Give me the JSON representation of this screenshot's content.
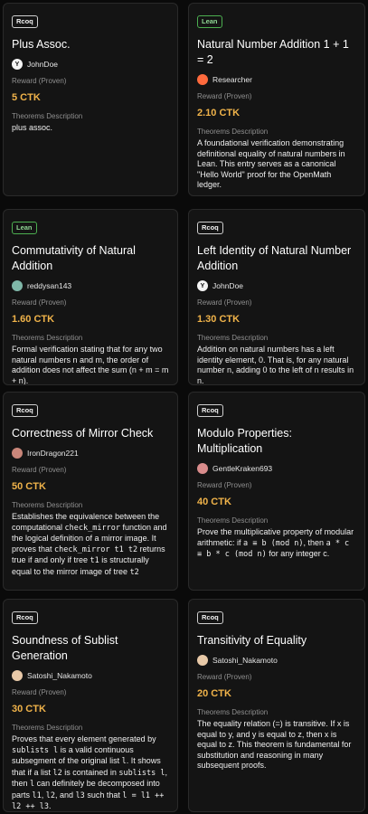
{
  "cards": [
    {
      "tag": "Rcoq",
      "tag_kind": "coq",
      "title": "Plus Assoc.",
      "author": "JohnDoe",
      "avatar_color": "#f5f5f5",
      "avatar_glyph": "Y",
      "reward_label": "Reward (Proven)",
      "reward": "5 CTK",
      "desc_label": "Theorems Description",
      "desc": [
        {
          "t": "plus assoc."
        }
      ]
    },
    {
      "tag": "Lean",
      "tag_kind": "lean",
      "title": "Natural Number Addition 1 + 1 = 2",
      "author": "Researcher",
      "avatar_color": "#ff6a3d",
      "avatar_glyph": "",
      "reward_label": "Reward (Proven)",
      "reward": "2.10 CTK",
      "desc_label": "Theorems Description",
      "desc": [
        {
          "t": "A foundational verification demonstrating definitional equality of natural numbers in Lean. This entry serves as a canonical \"Hello World\" proof for the OpenMath ledger."
        }
      ]
    },
    {
      "tag": "Lean",
      "tag_kind": "lean",
      "title": "Commutativity of Natural Addition",
      "author": "reddysan143",
      "avatar_color": "#7fb7a8",
      "avatar_glyph": "",
      "reward_label": "Reward (Proven)",
      "reward": "1.60 CTK",
      "desc_label": "Theorems Description",
      "desc": [
        {
          "t": "Formal verification stating that for any two natural numbers n and m, the order of addition does not affect the sum (n + m = m + n)."
        }
      ]
    },
    {
      "tag": "Rcoq",
      "tag_kind": "coq",
      "title": "Left Identity of Natural Number Addition",
      "author": "JohnDoe",
      "avatar_color": "#f5f5f5",
      "avatar_glyph": "Y",
      "reward_label": "Reward (Proven)",
      "reward": "1.30 CTK",
      "desc_label": "Theorems Description",
      "desc": [
        {
          "t": "Addition on natural numbers has a left identity element, 0. That is, for any natural number n, adding 0 to the left of n results in n."
        }
      ]
    },
    {
      "tag": "Rcoq",
      "tag_kind": "coq",
      "title": "Correctness of Mirror Check",
      "author": "IronDragon221",
      "avatar_color": "#c9867a",
      "avatar_glyph": "",
      "reward_label": "Reward (Proven)",
      "reward": "50 CTK",
      "desc_label": "Theorems Description",
      "desc": [
        {
          "t": "Establishes the equivalence between the computational "
        },
        {
          "t": "check_mirror",
          "m": true
        },
        {
          "t": " function and the logical definition of a mirror image. It proves that "
        },
        {
          "t": "check_mirror t1 t2",
          "m": true
        },
        {
          "t": " returns true if and only if tree "
        },
        {
          "t": "t1",
          "m": true
        },
        {
          "t": " is structurally equal to the mirror image of tree "
        },
        {
          "t": "t2",
          "m": true
        }
      ]
    },
    {
      "tag": "Rcoq",
      "tag_kind": "coq",
      "title": "Modulo Properties: Multiplication",
      "author": "GentleKraken693",
      "avatar_color": "#d98c8c",
      "avatar_glyph": "",
      "reward_label": "Reward (Proven)",
      "reward": "40 CTK",
      "desc_label": "Theorems Description",
      "desc": [
        {
          "t": "Prove the multiplicative property of modular arithmetic: if "
        },
        {
          "t": "a ≡ b (mod n)",
          "m": true
        },
        {
          "t": ", then "
        },
        {
          "t": "a * c ≡ b * c (mod n)",
          "m": true
        },
        {
          "t": " for any integer c."
        }
      ]
    },
    {
      "tag": "Rcoq",
      "tag_kind": "coq",
      "title": "Soundness of Sublist Generation",
      "author": "Satoshi_Nakamoto",
      "avatar_color": "#e8c9a8",
      "avatar_glyph": "",
      "reward_label": "Reward (Proven)",
      "reward": "30 CTK",
      "desc_label": "Theorems Description",
      "desc": [
        {
          "t": "Proves that every element generated by "
        },
        {
          "t": "sublists l",
          "m": true
        },
        {
          "t": " is a valid continuous subsegment of the original list "
        },
        {
          "t": "l",
          "m": true
        },
        {
          "t": ". It shows that if a list "
        },
        {
          "t": "l2",
          "m": true
        },
        {
          "t": " is contained in "
        },
        {
          "t": "sublists l",
          "m": true
        },
        {
          "t": ", then "
        },
        {
          "t": "l",
          "m": true
        },
        {
          "t": " can definitely be decomposed into parts "
        },
        {
          "t": "l1",
          "m": true
        },
        {
          "t": ", "
        },
        {
          "t": "l2",
          "m": true
        },
        {
          "t": ", and "
        },
        {
          "t": "l3",
          "m": true
        },
        {
          "t": " such that "
        },
        {
          "t": "l = l1 ++ l2 ++ l3",
          "m": true
        },
        {
          "t": "."
        }
      ]
    },
    {
      "tag": "Rcoq",
      "tag_kind": "coq",
      "title": "Transitivity of Equality",
      "author": "Satoshi_Nakamoto",
      "avatar_color": "#e8c9a8",
      "avatar_glyph": "",
      "reward_label": "Reward (Proven)",
      "reward": "20 CTK",
      "desc_label": "Theorems Description",
      "desc": [
        {
          "t": "The equality relation (=) is transitive. If x is equal to y, and y is equal to z, then x is equal to z. This theorem is fundamental for substitution and reasoning in many subsequent proofs."
        }
      ]
    }
  ]
}
